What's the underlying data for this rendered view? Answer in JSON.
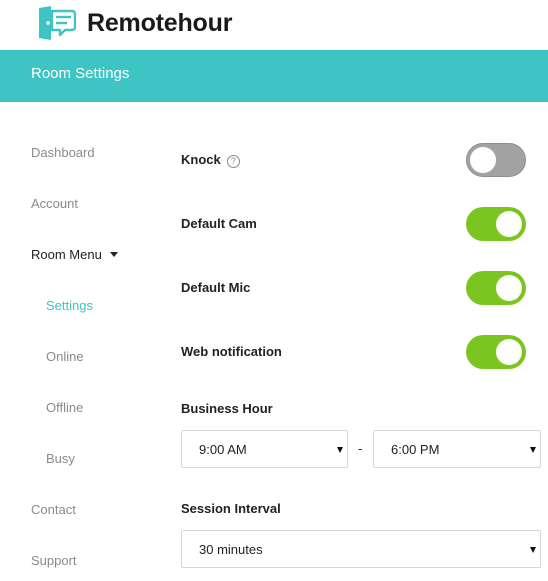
{
  "brand": {
    "name": "Remotehour",
    "icon": "door-chat-logo-icon",
    "accent": "#3ec4c2"
  },
  "header": {
    "title": "Room Settings",
    "background": "#3ec4c2"
  },
  "sidebar": {
    "items": [
      {
        "label": "Dashboard"
      },
      {
        "label": "Account"
      },
      {
        "label": "Room Menu",
        "icon": "caret-down-icon"
      },
      {
        "label": "Settings",
        "active": true
      },
      {
        "label": "Online"
      },
      {
        "label": "Offline"
      },
      {
        "label": "Busy"
      },
      {
        "label": "Contact"
      },
      {
        "label": "Support"
      }
    ]
  },
  "settings": {
    "knock": {
      "label": "Knock",
      "help_icon": "question-circle-icon",
      "help_glyph": "?",
      "enabled": false
    },
    "default_cam": {
      "label": "Default Cam",
      "enabled": true
    },
    "default_mic": {
      "label": "Default Mic",
      "enabled": true
    },
    "web_notification": {
      "label": "Web notification",
      "enabled": true
    },
    "business_hour": {
      "label": "Business Hour",
      "start": "9:00 AM",
      "separator": "-",
      "end": "6:00 PM"
    },
    "session_interval": {
      "label": "Session Interval",
      "value": "30 minutes"
    }
  },
  "colors": {
    "toggle_on": "#7ac520",
    "toggle_off": "#a2a2a2",
    "active_nav": "#3ec4c2"
  }
}
